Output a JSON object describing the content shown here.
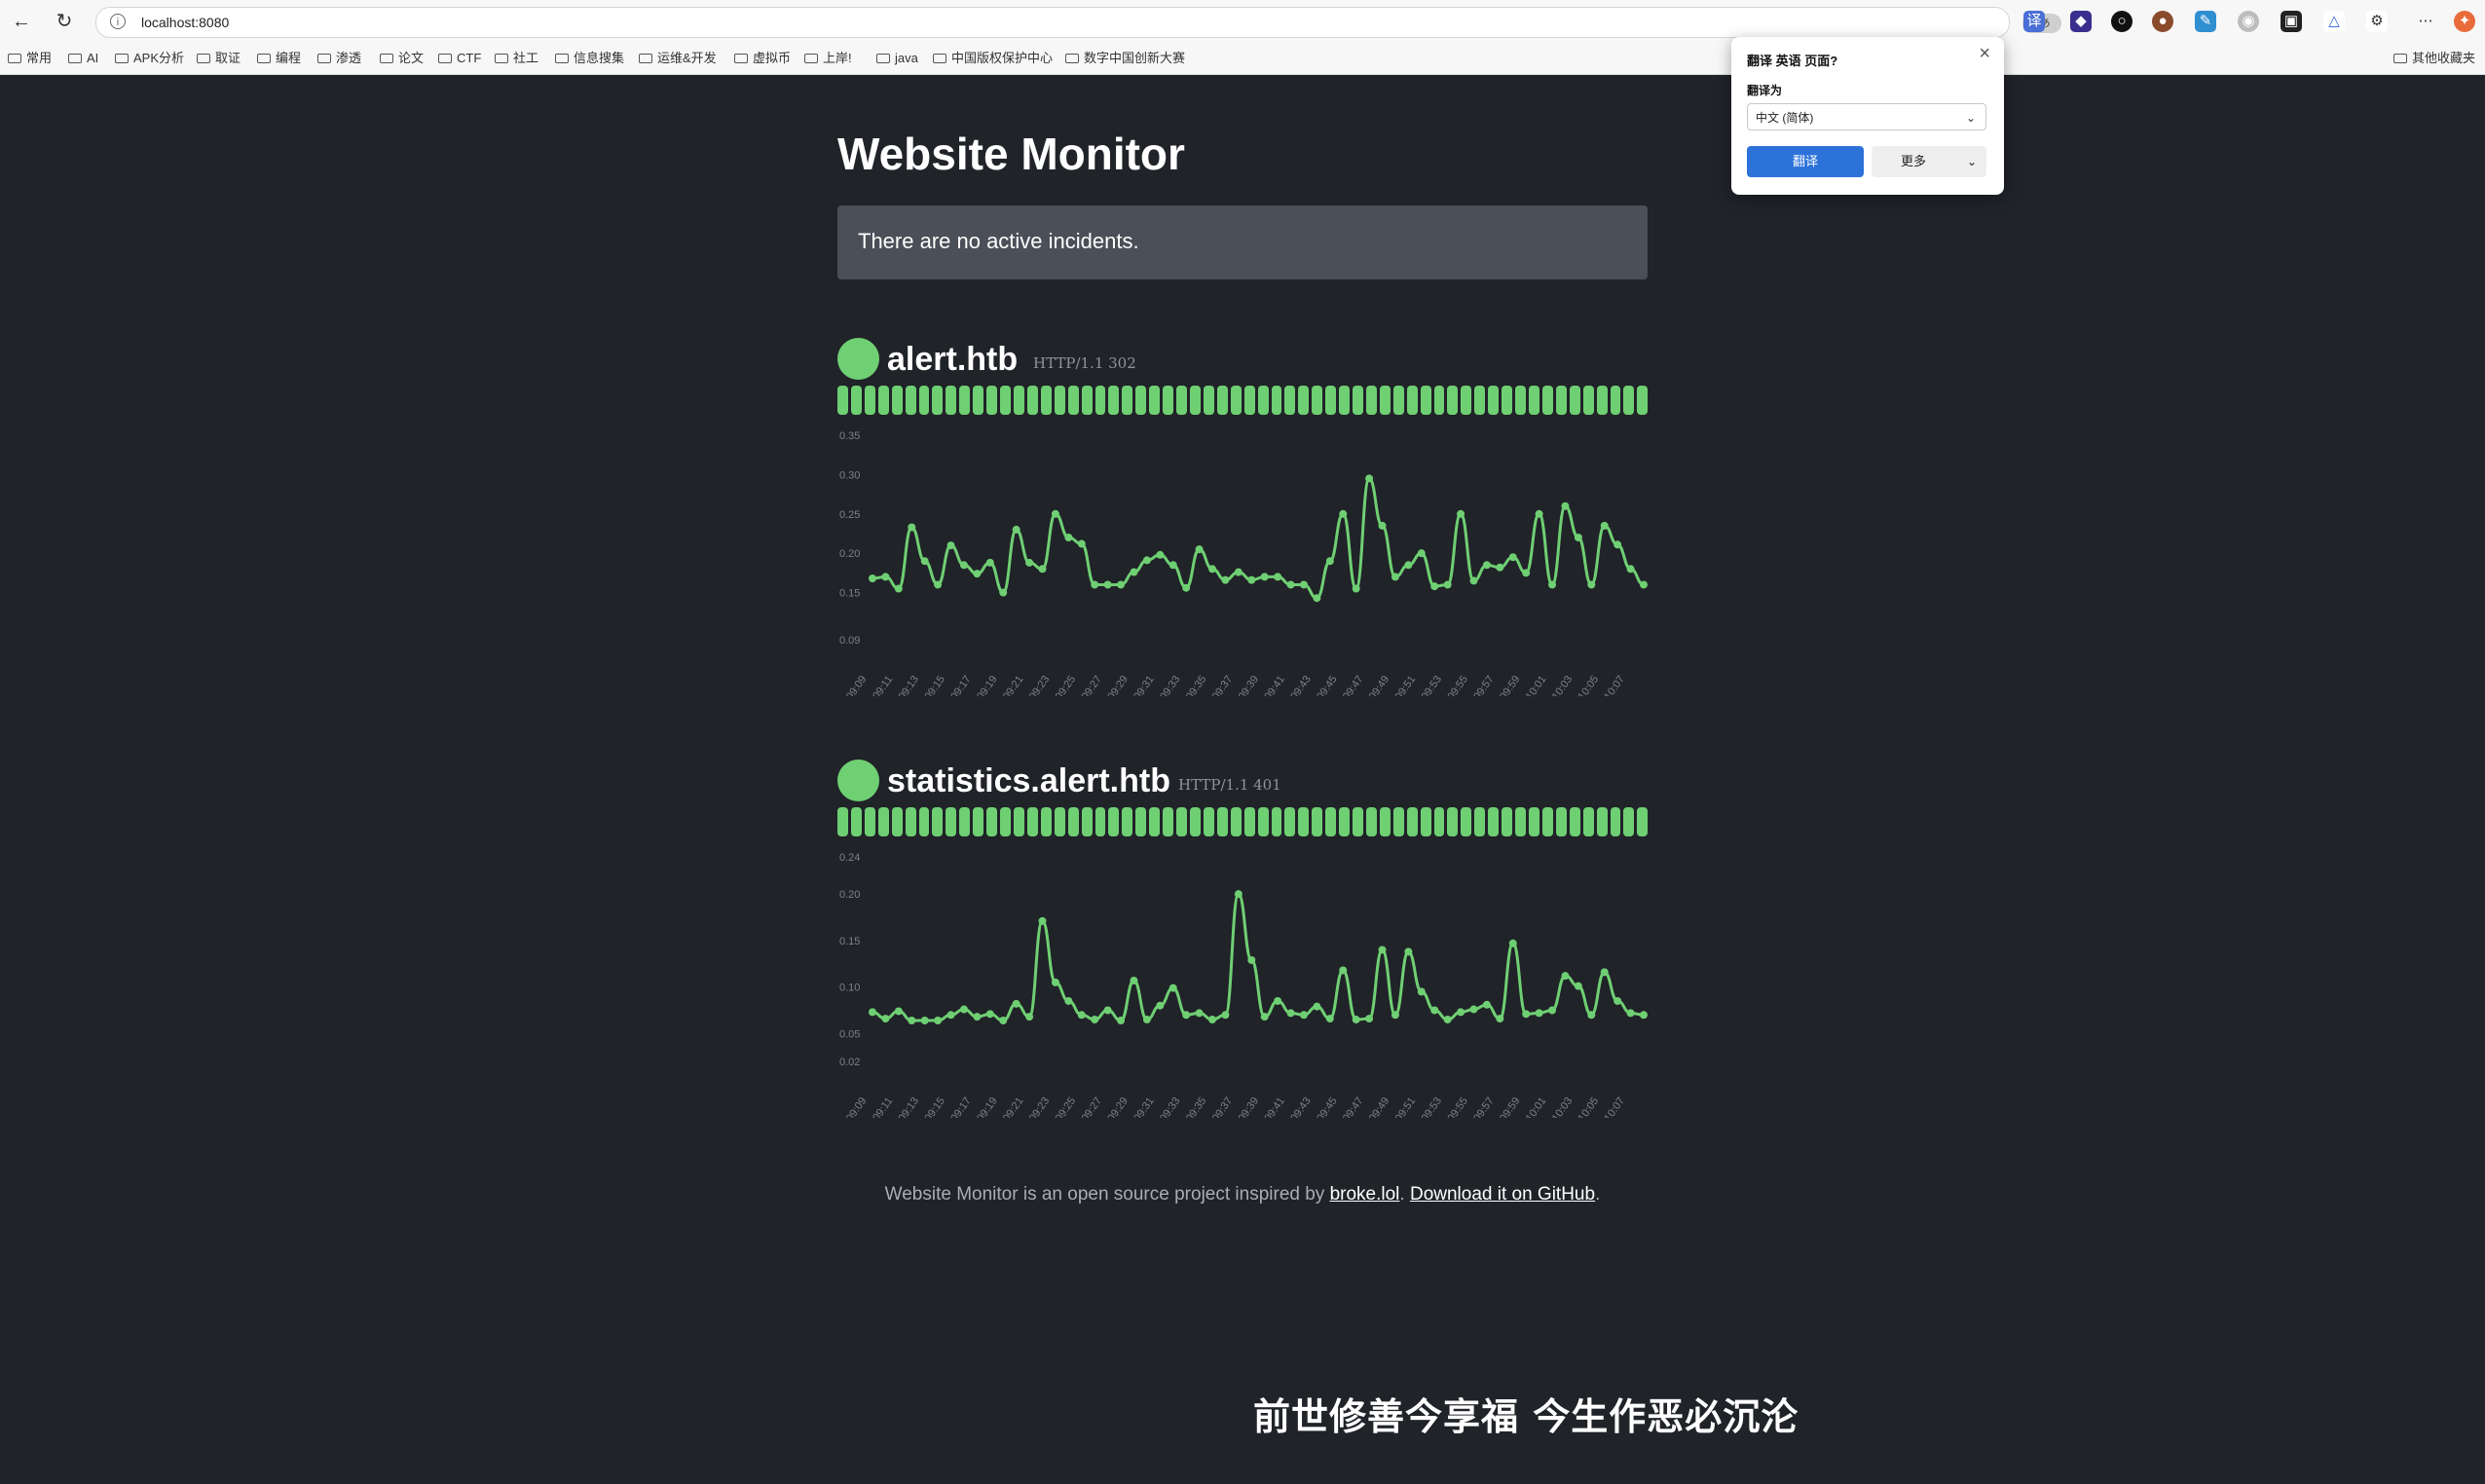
{
  "browser": {
    "url": "localhost:8080",
    "translate_badge": "aあ",
    "bookmarks": [
      "常用",
      "AI",
      "APK分析",
      "取证",
      "编程",
      "渗透",
      "论文",
      "CTF",
      "社工",
      "信息搜集",
      "运维&开发",
      "虚拟币",
      "上岸!",
      "java",
      "中国版权保护中心",
      "数字中国创新大赛"
    ],
    "other_bookmarks": "其他收藏夹"
  },
  "translate_popup": {
    "title": "翻译 英语 页面?",
    "label": "翻译为",
    "language": "中文 (简体)",
    "translate_button": "翻译",
    "more_button": "更多"
  },
  "page": {
    "title": "Website Monitor",
    "incident_text": "There are no active incidents."
  },
  "sites": [
    {
      "name": "alert.htb",
      "status": "HTTP/1.1 302",
      "uptime_segments": 60,
      "chart_data": {
        "type": "line",
        "color": "#6fcf73",
        "ylim": [
          0.09,
          0.35
        ],
        "yticks": [
          "0.35",
          "0.30",
          "0.25",
          "0.20",
          "0.15",
          "0.09"
        ],
        "xticks": [
          "09:09",
          "09:11",
          "09:13",
          "09:15",
          "09:17",
          "09:19",
          "09:21",
          "09:23",
          "09:25",
          "09:27",
          "09:29",
          "09:31",
          "09:33",
          "09:35",
          "09:37",
          "09:39",
          "09:41",
          "09:43",
          "09:45",
          "09:47",
          "09:49",
          "09:51",
          "09:53",
          "09:55",
          "09:57",
          "09:59",
          "10:01",
          "10:03",
          "10:05",
          "10:07"
        ],
        "values": [
          0.168,
          0.17,
          0.155,
          0.233,
          0.19,
          0.16,
          0.21,
          0.185,
          0.174,
          0.188,
          0.15,
          0.23,
          0.188,
          0.18,
          0.25,
          0.22,
          0.212,
          0.16,
          0.16,
          0.16,
          0.176,
          0.191,
          0.198,
          0.185,
          0.156,
          0.205,
          0.18,
          0.166,
          0.176,
          0.166,
          0.17,
          0.17,
          0.16,
          0.16,
          0.143,
          0.19,
          0.25,
          0.155,
          0.295,
          0.235,
          0.17,
          0.185,
          0.2,
          0.158,
          0.16,
          0.25,
          0.165,
          0.185,
          0.182,
          0.195,
          0.175,
          0.25,
          0.16,
          0.26,
          0.22,
          0.16,
          0.235,
          0.211,
          0.18,
          0.16
        ]
      }
    },
    {
      "name": "statistics.alert.htb",
      "status": "HTTP/1.1 401",
      "uptime_segments": 60,
      "chart_data": {
        "type": "line",
        "color": "#6fcf73",
        "ylim": [
          0.02,
          0.24
        ],
        "yticks": [
          "0.24",
          "0.20",
          "0.15",
          "0.10",
          "0.05",
          "0.02"
        ],
        "xticks": [
          "09:09",
          "09:11",
          "09:13",
          "09:15",
          "09:17",
          "09:19",
          "09:21",
          "09:23",
          "09:25",
          "09:27",
          "09:29",
          "09:31",
          "09:33",
          "09:35",
          "09:37",
          "09:39",
          "09:41",
          "09:43",
          "09:45",
          "09:47",
          "09:49",
          "09:51",
          "09:53",
          "09:55",
          "09:57",
          "09:59",
          "10:01",
          "10:03",
          "10:05",
          "10:07"
        ],
        "values": [
          0.073,
          0.066,
          0.074,
          0.064,
          0.064,
          0.064,
          0.07,
          0.076,
          0.068,
          0.071,
          0.064,
          0.082,
          0.068,
          0.171,
          0.105,
          0.085,
          0.07,
          0.065,
          0.075,
          0.064,
          0.107,
          0.065,
          0.08,
          0.099,
          0.07,
          0.072,
          0.065,
          0.07,
          0.2,
          0.129,
          0.068,
          0.085,
          0.072,
          0.07,
          0.079,
          0.066,
          0.118,
          0.065,
          0.066,
          0.14,
          0.07,
          0.138,
          0.095,
          0.075,
          0.065,
          0.073,
          0.076,
          0.081,
          0.066,
          0.147,
          0.071,
          0.072,
          0.075,
          0.112,
          0.101,
          0.07,
          0.116,
          0.085,
          0.072,
          0.07
        ]
      }
    }
  ],
  "footer": {
    "text": "Website Monitor is an open source project inspired by ",
    "link1": "broke.lol",
    "sep": ". ",
    "link2": "Download it on GitHub",
    "end": "."
  },
  "overlay_caption": "前世修善今享福 今生作恶必沉沦"
}
